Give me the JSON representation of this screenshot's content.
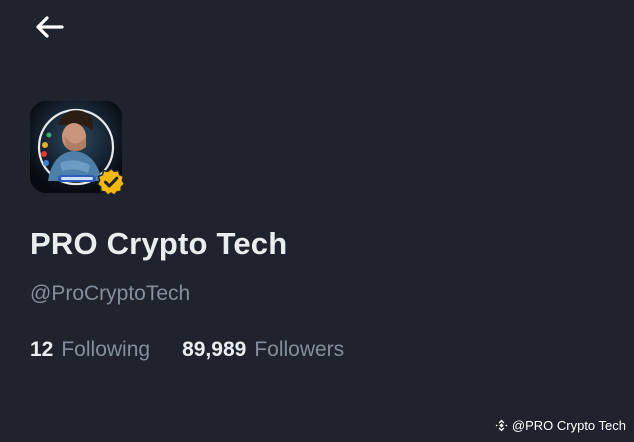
{
  "header": {
    "back_icon": "arrow-left-icon"
  },
  "profile": {
    "avatar_icon": "profile-avatar",
    "verified_icon": "verified-check-icon",
    "verified_color": "#f0b90b",
    "display_name": "PRO Crypto Tech",
    "handle": "@ProCryptoTech",
    "following_count": "12",
    "following_label": "Following",
    "followers_count": "89,989",
    "followers_label": "Followers"
  },
  "watermark": {
    "icon": "binance-logo-icon",
    "text": "@PRO Crypto Tech"
  },
  "colors": {
    "background": "#1f232d",
    "primary_text": "#eaecef",
    "secondary_text": "#848e9c",
    "accent": "#f0b90b"
  }
}
